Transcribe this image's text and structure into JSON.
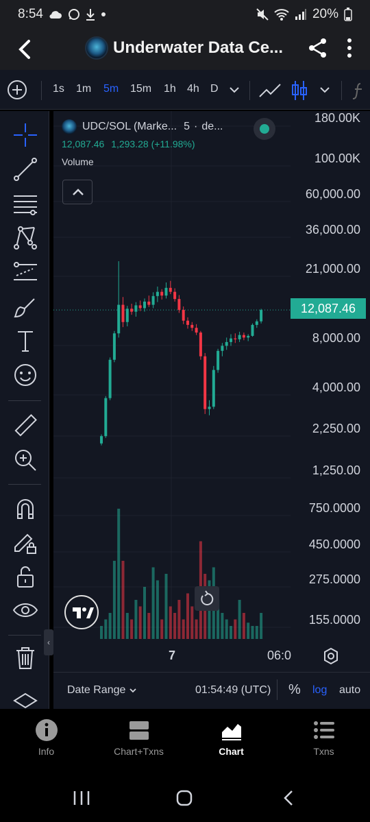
{
  "status_bar": {
    "time": "8:54",
    "battery": "20%"
  },
  "header": {
    "title": "Underwater Data Ce..."
  },
  "toolbar": {
    "timeframes": [
      "1s",
      "1m",
      "5m",
      "15m",
      "1h",
      "4h",
      "D"
    ],
    "active_timeframe": "5m"
  },
  "legend": {
    "symbol": "UDC/SOL (Marke...",
    "interval": "5",
    "source": "de...",
    "last_price": "12,087.46",
    "change": "1,293.28 (+11.98%)",
    "volume_label": "Volume"
  },
  "price_axis": [
    "180.00K",
    "100.00K",
    "60,000.00",
    "36,000.00",
    "21,000.00",
    "8,000.00",
    "4,000.00",
    "2,250.00",
    "1,250.00",
    "750.0000",
    "450.0000",
    "275.0000",
    "155.0000"
  ],
  "current_price_tag": "12,087.46",
  "time_axis": {
    "day_label": "7",
    "time_label": "06:0"
  },
  "date_bar": {
    "date_range": "Date Range",
    "clock": "01:54:49 (UTC)",
    "percent": "%",
    "log": "log",
    "auto": "auto"
  },
  "bottom_nav": [
    {
      "label": "Info",
      "icon": "info-icon"
    },
    {
      "label": "Chart+Txns",
      "icon": "chart-txns-icon"
    },
    {
      "label": "Chart",
      "icon": "chart-icon"
    },
    {
      "label": "Txns",
      "icon": "list-icon"
    }
  ],
  "colors": {
    "up": "#22ab94",
    "down": "#f23645",
    "accent": "#2962ff",
    "background": "#131722"
  },
  "chart_data": {
    "type": "candlestick",
    "price_scale": "log",
    "price_range": [
      155,
      180000
    ],
    "current_price": 12087.46,
    "candles": [
      {
        "o": 1850,
        "h": 2100,
        "l": 1800,
        "c": 2050
      },
      {
        "o": 2050,
        "h": 3600,
        "l": 2000,
        "c": 3500
      },
      {
        "o": 3500,
        "h": 6200,
        "l": 3400,
        "c": 6000
      },
      {
        "o": 6000,
        "h": 9000,
        "l": 5800,
        "c": 8700
      },
      {
        "o": 8700,
        "h": 24000,
        "l": 8200,
        "c": 13000
      },
      {
        "o": 13000,
        "h": 14500,
        "l": 9500,
        "c": 10200
      },
      {
        "o": 10200,
        "h": 12800,
        "l": 9600,
        "c": 12300
      },
      {
        "o": 12300,
        "h": 13200,
        "l": 11300,
        "c": 11800
      },
      {
        "o": 11800,
        "h": 13500,
        "l": 11000,
        "c": 12900
      },
      {
        "o": 12900,
        "h": 13800,
        "l": 11900,
        "c": 12400
      },
      {
        "o": 12400,
        "h": 14200,
        "l": 11800,
        "c": 13600
      },
      {
        "o": 13600,
        "h": 14800,
        "l": 12600,
        "c": 13000
      },
      {
        "o": 13000,
        "h": 15500,
        "l": 12400,
        "c": 14700
      },
      {
        "o": 14700,
        "h": 16800,
        "l": 13500,
        "c": 15600
      },
      {
        "o": 15600,
        "h": 16200,
        "l": 14000,
        "c": 14800
      },
      {
        "o": 14800,
        "h": 17800,
        "l": 14200,
        "c": 16500
      },
      {
        "o": 16500,
        "h": 18200,
        "l": 15100,
        "c": 15600
      },
      {
        "o": 15600,
        "h": 16400,
        "l": 13600,
        "c": 14100
      },
      {
        "o": 14100,
        "h": 14900,
        "l": 11600,
        "c": 12100
      },
      {
        "o": 12100,
        "h": 12700,
        "l": 9900,
        "c": 10400
      },
      {
        "o": 10400,
        "h": 10900,
        "l": 9300,
        "c": 9800
      },
      {
        "o": 9800,
        "h": 10200,
        "l": 9000,
        "c": 9400
      },
      {
        "o": 9400,
        "h": 9900,
        "l": 8500,
        "c": 8800
      },
      {
        "o": 8800,
        "h": 9000,
        "l": 6000,
        "c": 6300
      },
      {
        "o": 6300,
        "h": 6600,
        "l": 2800,
        "c": 3000
      },
      {
        "o": 3000,
        "h": 3400,
        "l": 2750,
        "c": 3100
      },
      {
        "o": 3100,
        "h": 5500,
        "l": 3000,
        "c": 5200
      },
      {
        "o": 5200,
        "h": 7000,
        "l": 5000,
        "c": 6800
      },
      {
        "o": 6800,
        "h": 7600,
        "l": 6300,
        "c": 7300
      },
      {
        "o": 7300,
        "h": 8200,
        "l": 6900,
        "c": 7700
      },
      {
        "o": 7700,
        "h": 8600,
        "l": 7300,
        "c": 8100
      },
      {
        "o": 8100,
        "h": 8700,
        "l": 7600,
        "c": 8000
      },
      {
        "o": 8000,
        "h": 8900,
        "l": 7700,
        "c": 8500
      },
      {
        "o": 8500,
        "h": 8800,
        "l": 7900,
        "c": 8200
      },
      {
        "o": 8200,
        "h": 8600,
        "l": 7800,
        "c": 8400
      },
      {
        "o": 8400,
        "h": 10000,
        "l": 8300,
        "c": 9800
      },
      {
        "o": 9800,
        "h": 10600,
        "l": 9400,
        "c": 10300
      },
      {
        "o": 10300,
        "h": 12300,
        "l": 10000,
        "c": 12087
      }
    ],
    "volumes": [
      20,
      30,
      40,
      120,
      200,
      120,
      40,
      30,
      60,
      50,
      80,
      40,
      110,
      90,
      30,
      100,
      50,
      40,
      60,
      30,
      70,
      50,
      30,
      150,
      100,
      90,
      110,
      60,
      40,
      30,
      20,
      30,
      60,
      40,
      25,
      20,
      20,
      40
    ]
  }
}
